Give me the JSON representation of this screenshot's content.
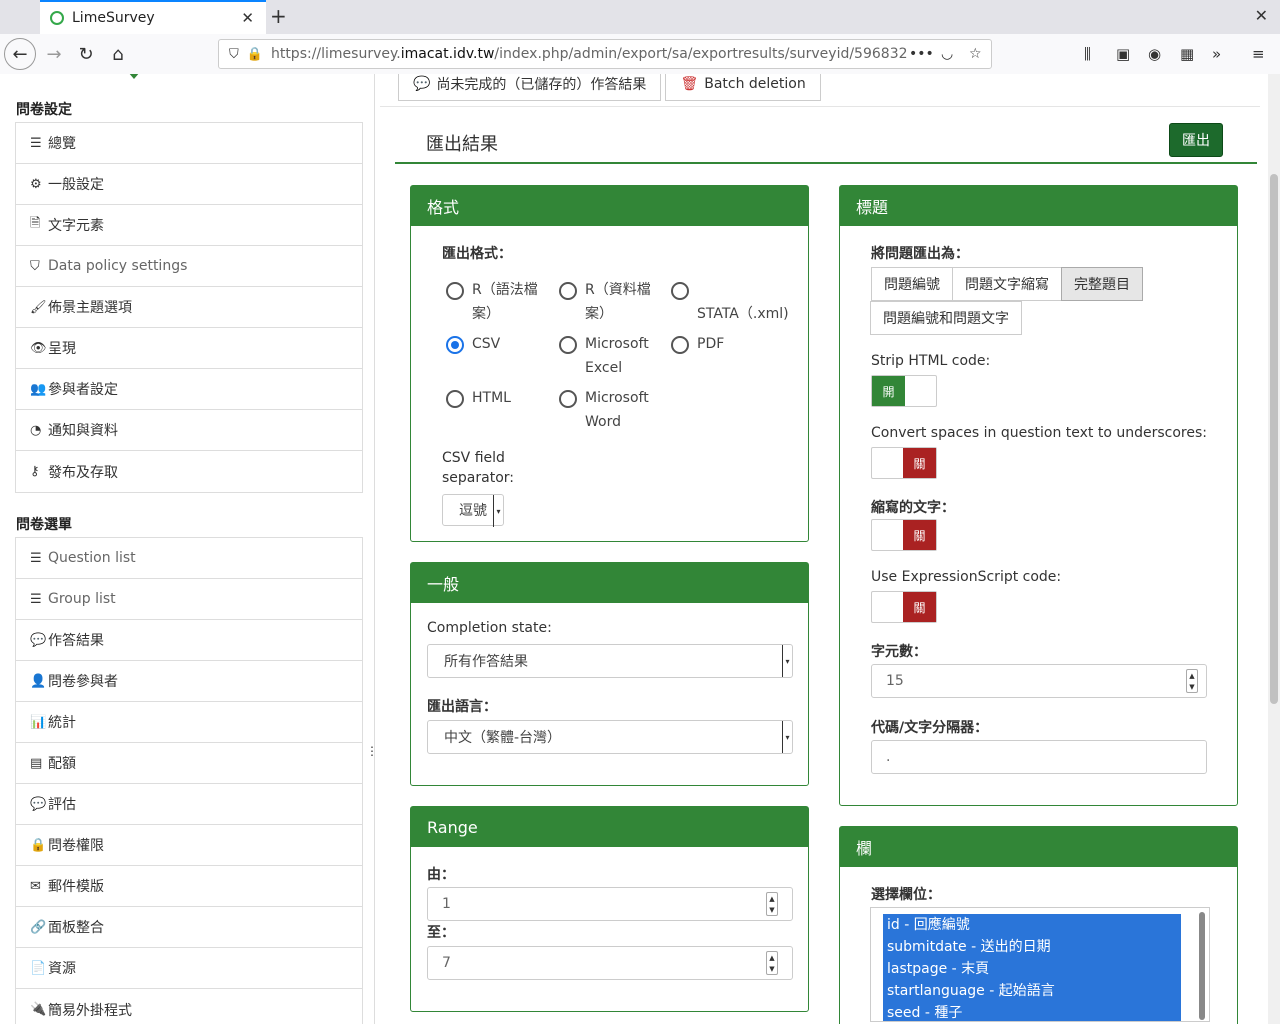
{
  "browser": {
    "tab_title": "LimeSurvey",
    "url_prefix": "https://limesurvey.",
    "url_domain": "imacat.idv.tw",
    "url_path": "/index.php/admin/export/sa/exportresults/surveyid/596832"
  },
  "sidebar": {
    "section1_title": "問卷設定",
    "settings_items": [
      {
        "icon": "list-icon",
        "glyph": "☰",
        "label": "總覽"
      },
      {
        "icon": "gears-icon",
        "glyph": "⚙",
        "label": "一般設定"
      },
      {
        "icon": "file-text-icon",
        "glyph": "🗎",
        "label": "文字元素"
      },
      {
        "icon": "shield-icon",
        "glyph": "⛉",
        "label": "Data policy settings"
      },
      {
        "icon": "brush-icon",
        "glyph": "🖌",
        "label": "佈景主題選項"
      },
      {
        "icon": "eye-slash-icon",
        "glyph": "👁",
        "label": "呈現"
      },
      {
        "icon": "users-icon",
        "glyph": "👥",
        "label": "參與者設定"
      },
      {
        "icon": "rss-icon",
        "glyph": "◔",
        "label": "通知與資料"
      },
      {
        "icon": "key-icon",
        "glyph": "⚷",
        "label": "發布及存取"
      }
    ],
    "section2_title": "問卷選單",
    "menu_items": [
      {
        "icon": "list-icon",
        "glyph": "☰",
        "label": "Question list"
      },
      {
        "icon": "list-icon",
        "glyph": "☰",
        "label": "Group list"
      },
      {
        "icon": "comment-icon",
        "glyph": "💬",
        "label": "作答結果"
      },
      {
        "icon": "user-icon",
        "glyph": "👤",
        "label": "問卷參與者"
      },
      {
        "icon": "bar-chart-icon",
        "glyph": "📊",
        "label": "統計"
      },
      {
        "icon": "tasks-icon",
        "glyph": "▤",
        "label": "配額"
      },
      {
        "icon": "comment-o-icon",
        "glyph": "💬",
        "label": "評估"
      },
      {
        "icon": "lock-icon",
        "glyph": "🔒",
        "label": "問卷權限"
      },
      {
        "icon": "envelope-icon",
        "glyph": "✉",
        "label": "郵件模版"
      },
      {
        "icon": "link-icon",
        "glyph": "🔗",
        "label": "面板整合"
      },
      {
        "icon": "file-icon",
        "glyph": "📄",
        "label": "資源"
      },
      {
        "icon": "plug-icon",
        "glyph": "🔌",
        "label": "簡易外掛程式"
      }
    ]
  },
  "toolbar": {
    "incomplete_label": "尚未完成的（已儲存的）作答結果",
    "batch_delete_label": "Batch deletion"
  },
  "page_title": "匯出結果",
  "export_button": "匯出",
  "format_panel": {
    "title": "格式",
    "export_format_label": "匯出格式：",
    "options": [
      {
        "line1": "R（語法檔",
        "line2": "案）",
        "selected": false
      },
      {
        "line1": "R（資料檔",
        "line2": "案）",
        "selected": false
      },
      {
        "line1": "",
        "line2": "STATA（.xml)",
        "selected": false
      },
      {
        "line1": "CSV",
        "line2": "",
        "selected": true
      },
      {
        "line1": "Microsoft",
        "line2": "Excel",
        "selected": false
      },
      {
        "line1": "PDF",
        "line2": "",
        "selected": false
      },
      {
        "line1": "HTML",
        "line2": "",
        "selected": false
      },
      {
        "line1": "Microsoft",
        "line2": "Word",
        "selected": false
      }
    ],
    "csv_sep_label1": "CSV field",
    "csv_sep_label2": "separator:",
    "csv_sep_value": "逗號"
  },
  "general_panel": {
    "title": "一般",
    "completion_label": "Completion state:",
    "completion_value": "所有作答結果",
    "language_label": "匯出語言：",
    "language_value": "中文（繁體-台灣）"
  },
  "range_panel": {
    "title": "Range",
    "from_label": "由：",
    "from_value": "1",
    "to_label": "至：",
    "to_value": "7"
  },
  "heading_panel": {
    "title": "標題",
    "export_question_as_label": "將問題匯出為：",
    "options": [
      "問題編號",
      "問題文字縮寫",
      "完整題目"
    ],
    "option4": "問題編號和問題文字",
    "active_option": "完整題目",
    "strip_html_label": "Strip HTML code:",
    "strip_html_state": "開",
    "convert_spaces_label": "Convert spaces in question text to underscores:",
    "convert_spaces_state": "關",
    "abbrev_label": "縮寫的文字：",
    "abbrev_state": "關",
    "exprscript_label": "Use ExpressionScript code:",
    "exprscript_state": "關",
    "char_count_label": "字元數：",
    "char_count_value": "15",
    "code_sep_label": "代碼/文字分隔器：",
    "code_sep_value": "."
  },
  "columns_panel": {
    "title": "欄",
    "select_label": "選擇欄位：",
    "fields": [
      {
        "code": "id",
        "text": "回應編號"
      },
      {
        "code": "submitdate",
        "text": "送出的日期"
      },
      {
        "code": "lastpage",
        "text": "末頁"
      },
      {
        "code": "startlanguage",
        "text": "起始語言"
      },
      {
        "code": "seed",
        "text": "種子"
      }
    ]
  }
}
